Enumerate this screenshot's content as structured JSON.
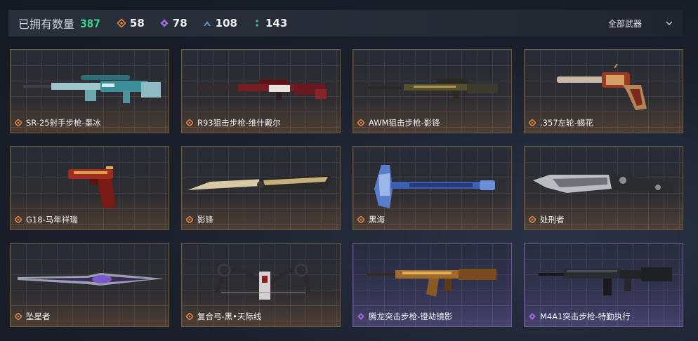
{
  "header": {
    "owned_label": "已拥有数量",
    "owned_count": "387",
    "stats": [
      {
        "icon": "orange-diamond-icon",
        "color": "#e08a3c",
        "value": "58"
      },
      {
        "icon": "purple-diamond-icon",
        "color": "#9b6bd6",
        "value": "78"
      },
      {
        "icon": "blue-chevron-icon",
        "color": "#4f92d8",
        "value": "108"
      },
      {
        "icon": "green-dots-icon",
        "color": "#3ac58a",
        "value": "143"
      }
    ],
    "filter_label": "全部武器"
  },
  "colors": {
    "accent_green": "#38e08e",
    "card_border_orange": "#6a5a44",
    "card_border_purple": "#6b5d8f",
    "rank_orange": "#e0884a",
    "rank_purple": "#9b6bd6"
  },
  "weapons": [
    {
      "name": "SR-25射手步枪-墨冰",
      "rank": "orange",
      "icon": "sniper-rifle-icon"
    },
    {
      "name": "R93狙击步枪-维什戴尔",
      "rank": "orange",
      "icon": "sniper-rifle-icon"
    },
    {
      "name": "AWM狙击步枪-影锋",
      "rank": "orange",
      "icon": "sniper-rifle-icon"
    },
    {
      "name": ".357左轮-蝎花",
      "rank": "orange",
      "icon": "revolver-icon"
    },
    {
      "name": "G18-马年祥瑞",
      "rank": "orange",
      "icon": "pistol-icon"
    },
    {
      "name": "影锋",
      "rank": "orange",
      "icon": "butterfly-knife-icon"
    },
    {
      "name": "黑海",
      "rank": "orange",
      "icon": "axe-icon"
    },
    {
      "name": "处刑者",
      "rank": "orange",
      "icon": "combat-knife-icon"
    },
    {
      "name": "坠星者",
      "rank": "orange",
      "icon": "dagger-icon"
    },
    {
      "name": "复合弓-黑•天际线",
      "rank": "orange",
      "icon": "compound-bow-icon"
    },
    {
      "name": "腾龙突击步枪-镫劫镜影",
      "rank": "purple",
      "icon": "assault-rifle-icon"
    },
    {
      "name": "M4A1突击步枪-特勤执行",
      "rank": "purple",
      "icon": "assault-rifle-icon"
    }
  ]
}
